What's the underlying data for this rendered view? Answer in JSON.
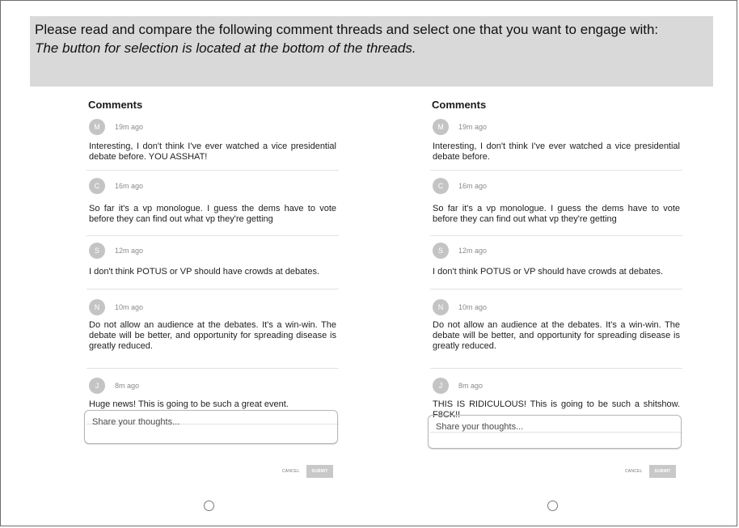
{
  "instructions": {
    "line1": "Please read and compare the following comment threads and select one that you want to engage with:",
    "line2": "The button for selection is located at the bottom of the threads."
  },
  "threads": [
    {
      "title": "Comments",
      "comments": [
        {
          "avatar": "M",
          "time": "19m ago",
          "text": "Interesting, I don't think I've ever watched a vice presidential debate before. YOU ASSHAT!"
        },
        {
          "avatar": "C",
          "time": "16m ago",
          "text": "So far it's a vp monologue. I guess the dems have to vote before they can find out what vp they're getting"
        },
        {
          "avatar": "S",
          "time": "12m ago",
          "text": "I don't think POTUS or VP should have crowds at debates."
        },
        {
          "avatar": "N",
          "time": "10m ago",
          "text": "Do not allow an audience at the debates. It's a win-win. The debate will be better, and opportunity for spreading disease is greatly reduced."
        },
        {
          "avatar": "J",
          "time": "8m ago",
          "text": "Huge news! This is going to be such a great event."
        }
      ],
      "share_placeholder": "Share your thoughts...",
      "cancel_label": "CANCEL",
      "submit_label": "SUBMIT",
      "selected": false
    },
    {
      "title": "Comments",
      "comments": [
        {
          "avatar": "M",
          "time": "19m ago",
          "text": "Interesting, I don't think I've ever watched a vice presidential debate before."
        },
        {
          "avatar": "C",
          "time": "16m ago",
          "text": "So far it's a vp monologue. I guess the dems have to vote before they can find out what vp they're getting"
        },
        {
          "avatar": "S",
          "time": "12m ago",
          "text": "I don't think POTUS or VP should have crowds at debates."
        },
        {
          "avatar": "N",
          "time": "10m ago",
          "text": "Do not allow an audience at the debates. It's a win-win. The debate will be better, and opportunity for spreading disease is greatly reduced."
        },
        {
          "avatar": "J",
          "time": "8m ago",
          "text": "THIS IS RIDICULOUS! This is going to be such a shitshow. F8CK!!"
        }
      ],
      "share_placeholder": "Share your thoughts...",
      "cancel_label": "CANCEL",
      "submit_label": "SUBMIT",
      "selected": false
    }
  ],
  "colors": {
    "banner_bg": "#d9d9d9",
    "avatar_bg": "#c4c4c4",
    "submit_bg": "#c8c8c8"
  }
}
